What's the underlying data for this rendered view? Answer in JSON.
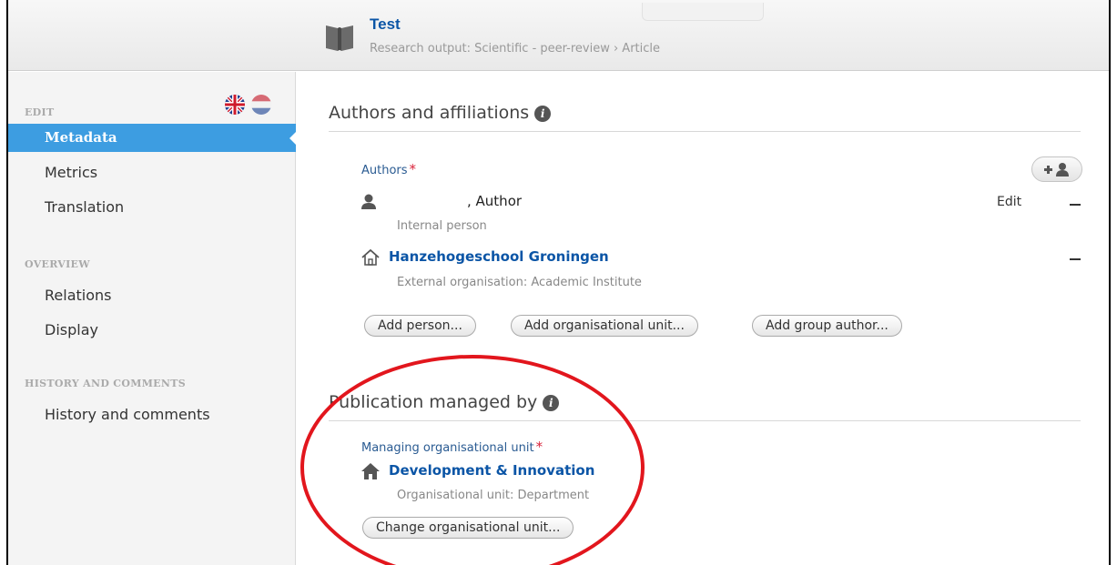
{
  "header": {
    "title": "Test",
    "subtitle": "Research output: Scientific - peer-review › Article",
    "icon": "book-icon"
  },
  "sidebar": {
    "edit_label": "EDIT",
    "items_edit": [
      {
        "label": "Metadata",
        "active": true
      },
      {
        "label": "Metrics"
      },
      {
        "label": "Translation"
      }
    ],
    "overview_label": "OVERVIEW",
    "items_overview": [
      {
        "label": "Relations"
      },
      {
        "label": "Display"
      }
    ],
    "history_label": "HISTORY AND COMMENTS",
    "items_history": [
      {
        "label": "History and comments"
      }
    ],
    "flags": [
      "flag-uk-icon",
      "flag-nl-icon"
    ]
  },
  "authors_section": {
    "title": "Authors and affiliations",
    "authors_label": "Authors",
    "required_mark": "*",
    "person_name": ", Author",
    "person_type": "Internal person",
    "edit_label": "Edit",
    "org_name": "Hanzehogeschool Groningen",
    "org_type": "External organisation: Academic Institute",
    "buttons": {
      "add_person": "Add person...",
      "add_org_unit": "Add organisational unit...",
      "add_group_author": "Add group author..."
    }
  },
  "managed_section": {
    "title": "Publication managed by",
    "field_label": "Managing organisational unit",
    "required_mark": "*",
    "unit_name": "Development & Innovation",
    "unit_type": "Organisational unit: Department",
    "change_button": "Change organisational unit..."
  },
  "colors": {
    "accent": "#3d9de1",
    "link": "#0b55a6",
    "label": "#2a5b92",
    "required": "#d9233a",
    "annotation": "#e2161d"
  }
}
